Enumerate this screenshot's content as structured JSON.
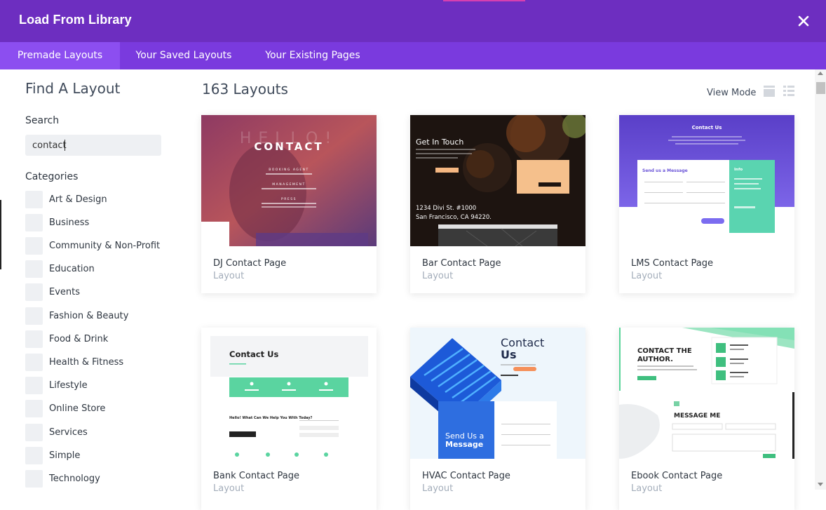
{
  "header": {
    "title": "Load From Library",
    "close_icon": "close-icon",
    "color": "#6d2ec0"
  },
  "tabs": [
    {
      "label": "Premade Layouts",
      "active": true
    },
    {
      "label": "Your Saved Layouts",
      "active": false
    },
    {
      "label": "Your Existing Pages",
      "active": false
    }
  ],
  "sidebar": {
    "title": "Find A Layout",
    "search_label": "Search",
    "search_value": "contact",
    "categories_label": "Categories",
    "categories": [
      "Art & Design",
      "Business",
      "Community & Non-Profit",
      "Education",
      "Events",
      "Fashion & Beauty",
      "Food & Drink",
      "Health & Fitness",
      "Lifestyle",
      "Online Store",
      "Services",
      "Simple",
      "Technology"
    ]
  },
  "main": {
    "count_label": "163 Layouts",
    "view_mode_label": "View Mode",
    "view_mode_icons": [
      "grid-view-icon",
      "list-view-icon"
    ],
    "layouts": [
      {
        "name": "DJ Contact Page",
        "type": "Layout"
      },
      {
        "name": "Bar Contact Page",
        "type": "Layout"
      },
      {
        "name": "LMS Contact Page",
        "type": "Layout"
      },
      {
        "name": "Bank Contact Page",
        "type": "Layout"
      },
      {
        "name": "HVAC Contact Page",
        "type": "Layout"
      },
      {
        "name": "Ebook Contact Page",
        "type": "Layout"
      }
    ],
    "thumbs": {
      "dj": {
        "heading": "CONTACT",
        "ghost": "HELLO!",
        "lines": [
          "BOOKING AGENT",
          "MANAGEMENT",
          "PRESS"
        ]
      },
      "bar": {
        "heading": "Get In Touch",
        "address1": "1234 Divi St. #1000",
        "address2": "San Francisco, CA 94220."
      },
      "lms": {
        "heading": "Contact Us",
        "form_title": "Send us a Message",
        "info_title": "Info"
      },
      "bank": {
        "heading": "Contact Us",
        "sub": "Hello! What Can We Help You With Today?"
      },
      "hvac": {
        "heading1": "Contact",
        "heading2": "Us",
        "card1": "Send Us a",
        "card2": "Message"
      },
      "ebook": {
        "heading1": "CONTACT THE",
        "heading2": "AUTHOR.",
        "message": "MESSAGE ME"
      }
    }
  }
}
